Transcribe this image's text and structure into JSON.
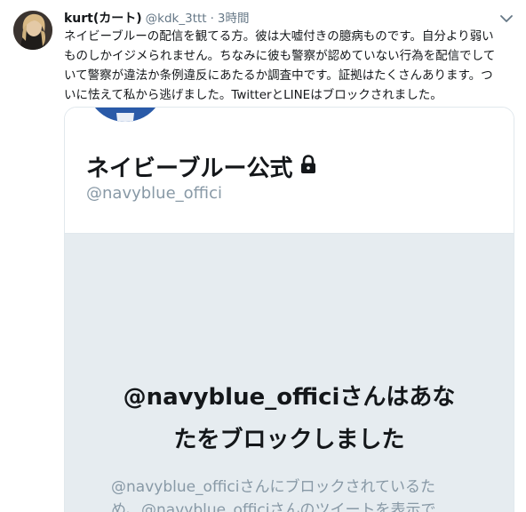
{
  "tweet": {
    "name": "kurt(カート)",
    "handle": "@kdk_3ttt",
    "separator": "·",
    "time": "3時間",
    "text_lines": [
      "ネイビーブルーの配信を観てる方。彼は大嘘付きの臆病ものです。自分より弱い",
      "ものしかイジメられません。ちなみに彼も警察が認めていない行為を配信でして",
      "いて警察が違法か条例違反にあたるか調査中です。証拠はたくさんあります。つ",
      "いに怯えて私から逃げました。TwitterとLINEはブロックされました。"
    ],
    "menu_icon": "chevron-down-icon",
    "avatar_icon": "user-avatar"
  },
  "card": {
    "profile_name": "ネイビーブルー公式",
    "profile_handle": "@navyblue_offici",
    "lock_icon": "lock-icon",
    "blocked_title_lines": [
      "@navyblue_officiさんはあな",
      "たをブロックしました"
    ],
    "blocked_desc_lines": [
      "@navyblue_officiさんにブロックされているた",
      "め、@navyblue_officiさんのツイートを表示で"
    ]
  },
  "colors": {
    "text": "#14171a",
    "secondary": "#657786",
    "muted": "#8899a6",
    "card_border": "#e1e8ed",
    "card_gray": "#e6ecf0"
  }
}
